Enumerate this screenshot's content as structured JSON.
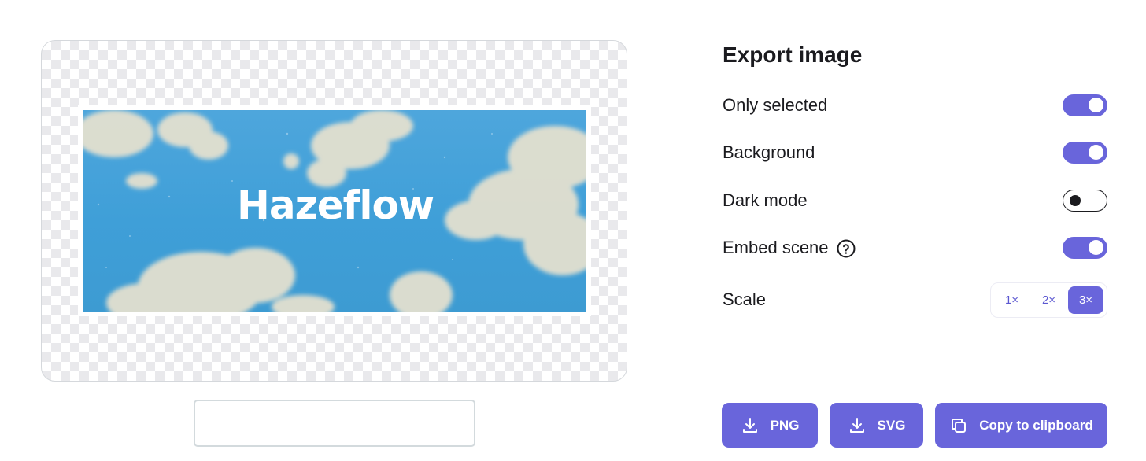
{
  "preview": {
    "logo_text": "Hazeflow"
  },
  "filename": {
    "value": ""
  },
  "panel": {
    "title": "Export image",
    "options": [
      {
        "label": "Only selected",
        "on": true
      },
      {
        "label": "Background",
        "on": true
      },
      {
        "label": "Dark mode",
        "on": false
      },
      {
        "label": "Embed scene",
        "on": true,
        "help_icon": "question-circle-icon"
      }
    ],
    "scale": {
      "label": "Scale",
      "options": [
        "1×",
        "2×",
        "3×"
      ],
      "selected": "3×"
    }
  },
  "actions": {
    "png_label": "PNG",
    "svg_label": "SVG",
    "copy_label": "Copy to clipboard"
  },
  "colors": {
    "accent": "#6965db",
    "sky": "#3f9fd8"
  }
}
